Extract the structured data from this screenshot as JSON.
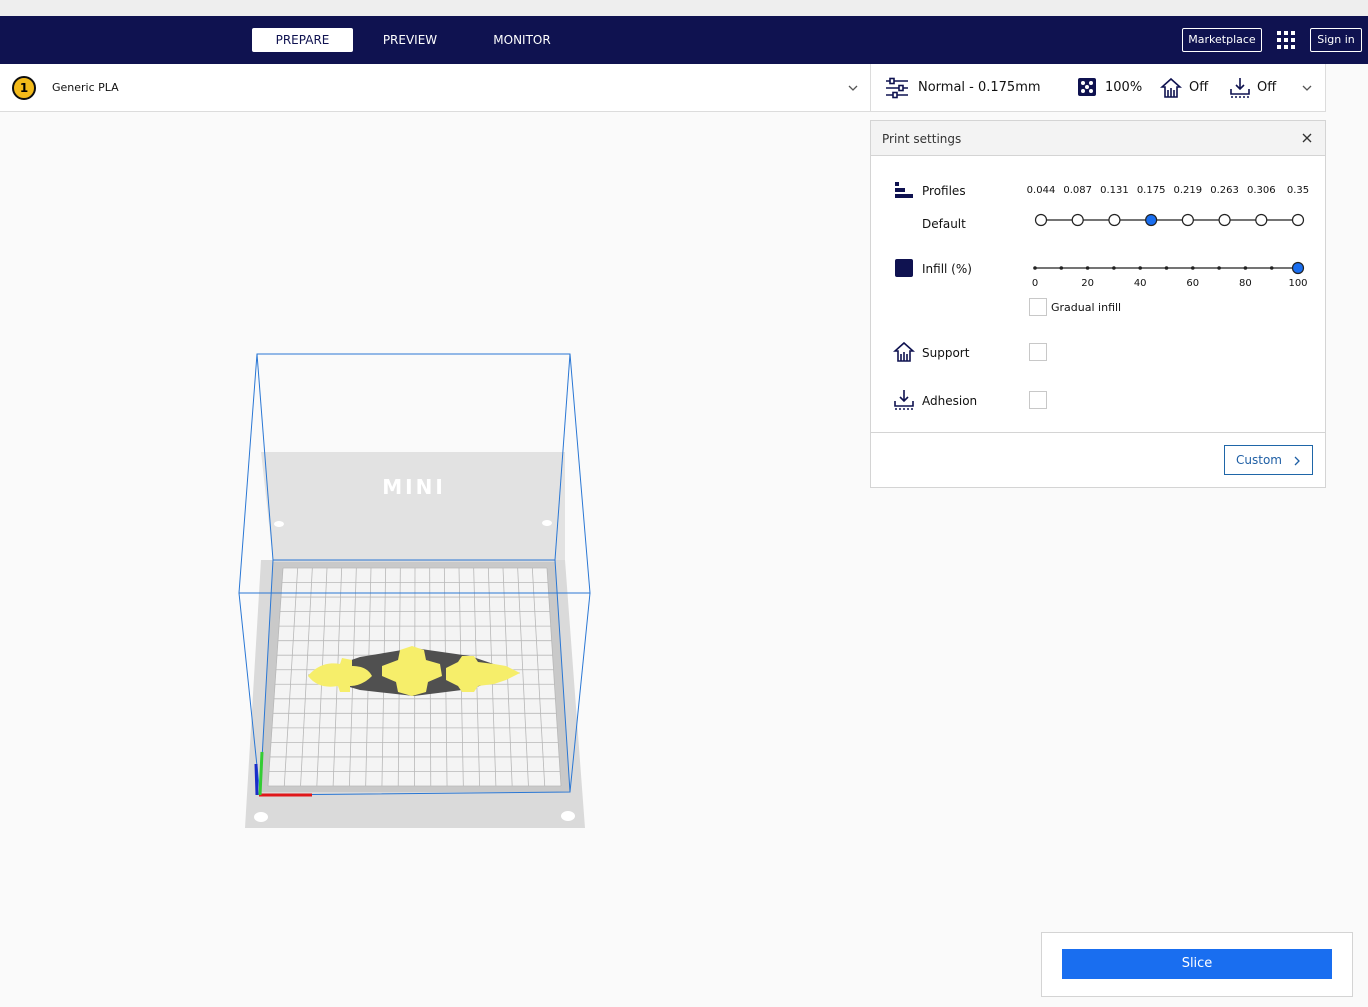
{
  "topbar": {
    "tabs": [
      {
        "label": "PREPARE",
        "active": true
      },
      {
        "label": "PREVIEW",
        "active": false
      },
      {
        "label": "MONITOR",
        "active": false
      }
    ],
    "marketplace_label": "Marketplace",
    "signin_label": "Sign in",
    "apps_icon": "apps-grid-icon"
  },
  "material": {
    "extruder_number": "1",
    "material_name": "Generic PLA"
  },
  "settings_bar": {
    "profile_label": "Normal - 0.175mm",
    "infill_label": "100%",
    "support_label": "Off",
    "adhesion_label": "Off"
  },
  "print_settings": {
    "title": "Print settings",
    "profiles_label": "Profiles",
    "profile_name": "Default",
    "layer_heights": [
      "0.044",
      "0.087",
      "0.131",
      "0.175",
      "0.219",
      "0.263",
      "0.306",
      "0.35"
    ],
    "selected_layer_height_index": 3,
    "infill_label": "Infill (%)",
    "infill_ticks": [
      "0",
      "20",
      "40",
      "60",
      "80",
      "100"
    ],
    "infill_value": 100,
    "gradual_infill_label": "Gradual infill",
    "gradual_infill_checked": false,
    "support_label": "Support",
    "support_checked": false,
    "adhesion_label": "Adhesion",
    "adhesion_checked": false,
    "custom_label": "Custom"
  },
  "slice": {
    "button_label": "Slice"
  },
  "viewport": {
    "printer_logo_text": "MINI"
  },
  "colors": {
    "header_bg": "#0f1250",
    "accent_blue": "#196ef0",
    "model_yellow": "#f6ee6a",
    "extruder_yellow": "#f3ba1a"
  }
}
